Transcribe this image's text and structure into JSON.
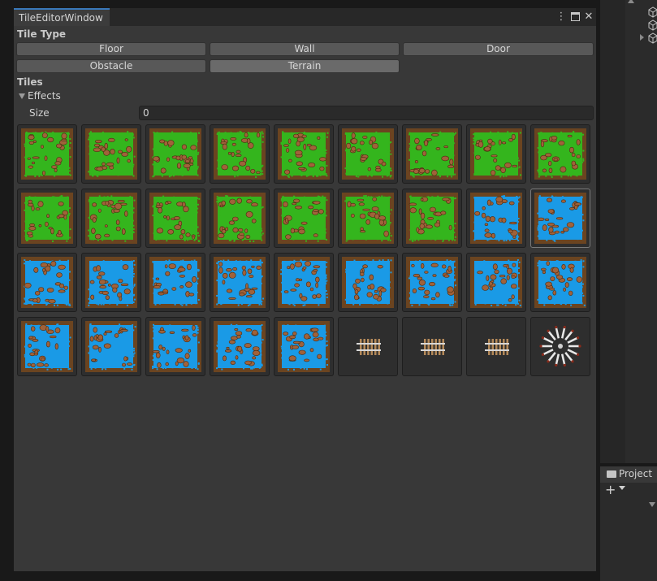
{
  "window": {
    "tab_title": "TileEditorWindow",
    "menu_icon": "kebab-menu-icon",
    "maximize_icon": "maximize-icon",
    "close_icon": "close-icon"
  },
  "tile_type": {
    "label": "Tile Type",
    "selected": "Terrain",
    "buttons": [
      "Floor",
      "Wall",
      "Door",
      "Obstacle",
      "Terrain"
    ]
  },
  "tiles": {
    "label": "Tiles",
    "effects_label": "Effects",
    "size_label": "Size",
    "size_value": "0",
    "selected_index": 17,
    "grid": [
      "grass",
      "grass",
      "grass",
      "grass",
      "grass",
      "grass",
      "grass",
      "grass",
      "grass",
      "grass",
      "grass",
      "grass",
      "grass",
      "grass",
      "grass",
      "grass",
      "water",
      "water",
      "water",
      "water",
      "water",
      "water",
      "water",
      "water",
      "water",
      "water",
      "water",
      "water",
      "water",
      "water",
      "water",
      "water",
      "rail",
      "rail",
      "rail",
      "spikes"
    ]
  },
  "colors": {
    "grass": "#34b51d",
    "water": "#1a9ae6",
    "dirt": "#6b4420",
    "rock": "#a0623a"
  },
  "project_panel": {
    "tab_label": "Project",
    "folder_icon": "folder-icon",
    "add_icon": "plus-icon"
  }
}
